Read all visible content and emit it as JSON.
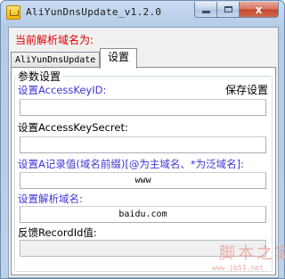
{
  "window": {
    "title": "AliYunDnsUpdate_v1.2.0",
    "icon": "app-folder-icon",
    "controls": {
      "minimize": "minimize-icon",
      "maximize": "maximize-icon",
      "close_label": "x"
    }
  },
  "header": {
    "domain_label": "当前解析域名为:"
  },
  "tabs": [
    {
      "label": "AliYunDnsUpdate",
      "selected": false
    },
    {
      "label": "设置",
      "selected": true
    }
  ],
  "settings": {
    "group_label": "参数设置",
    "access_key_id_label": "设置AccessKeyID:",
    "save_label": "保存设置",
    "access_key_id_value": "",
    "access_key_secret_label": "设置AccessKeySecret:",
    "access_key_secret_value": "",
    "record_label": "设置A记录值(域名前缀)[@为主域名、*为泛域名]:",
    "record_value": "www",
    "domain_name_label": "设置解析域名:",
    "domain_name_value": "baidu.com",
    "record_id_label": "反馈RecordId值:",
    "record_id_value": ""
  },
  "watermark": {
    "text": "脚本之家",
    "url": "www.jb51.net"
  },
  "colors": {
    "heading_red": "#e00000",
    "label_blue": "#3f35d4",
    "watermark": "#e9a39a"
  }
}
